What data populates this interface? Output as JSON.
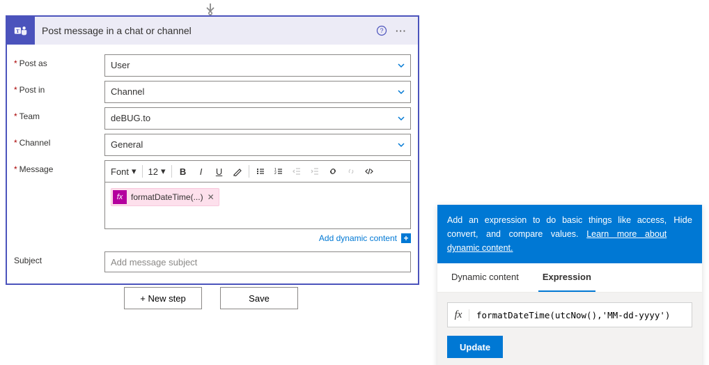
{
  "action": {
    "title": "Post message in a chat or channel",
    "help_aria": "Help",
    "more_aria": "More"
  },
  "fields": {
    "post_as": {
      "label": "Post as",
      "value": "User"
    },
    "post_in": {
      "label": "Post in",
      "value": "Channel"
    },
    "team": {
      "label": "Team",
      "value": "deBUG.to"
    },
    "channel": {
      "label": "Channel",
      "value": "General"
    },
    "message": {
      "label": "Message"
    },
    "subject": {
      "label": "Subject",
      "placeholder": "Add message subject"
    }
  },
  "toolbar": {
    "font_label": "Font",
    "size_label": "12"
  },
  "expression_pill": {
    "fx": "fx",
    "text": "formatDateTime(...)"
  },
  "dynamic_link": {
    "label": "Add dynamic content"
  },
  "buttons": {
    "new_step": "+ New step",
    "save": "Save"
  },
  "flyout": {
    "banner_text_1": "Add an expression to do basic things like access, convert, and compare values. ",
    "banner_link": "Learn more about dynamic content.",
    "hide": "Hide",
    "tab_dynamic": "Dynamic content",
    "tab_expression": "Expression",
    "fx": "fx",
    "expression_value": "formatDateTime(utcNow(),'MM-dd-yyyy')",
    "update": "Update"
  }
}
